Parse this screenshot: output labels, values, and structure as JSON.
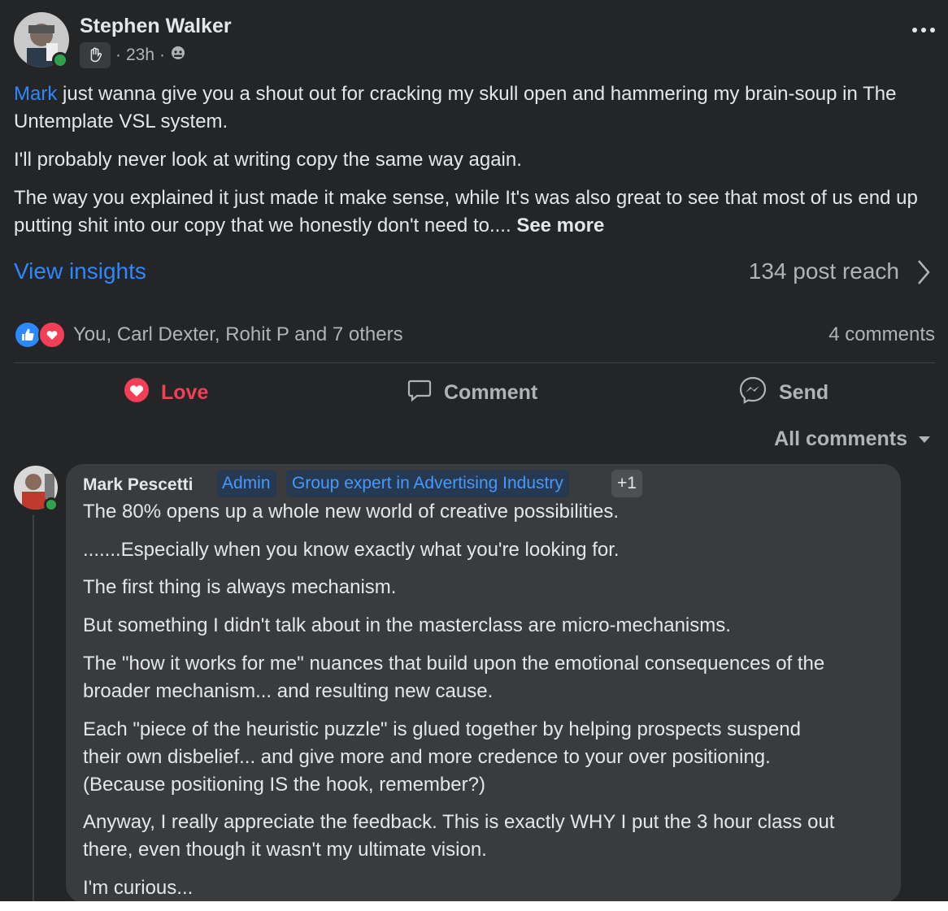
{
  "post": {
    "author": "Stephen Walker",
    "badge_icon": "waving-hand-icon",
    "time": "23h",
    "privacy_icon": "group-privacy-icon",
    "body": {
      "mention": "Mark",
      "p1_rest": " just wanna give you a shout out for cracking my skull open and hammering my brain-soup in The Untemplate VSL system.",
      "p2": "I'll probably never look at writing copy the same way again.",
      "p3": "The way you explained it just made it make sense, while It's was also great to see that most of us end up putting shit into our copy that we honestly don't need to.... ",
      "see_more": "See more"
    },
    "view_insights": "View insights",
    "reach": "134 post reach",
    "reactions_text": "You, Carl Dexter, Rohit P and 7 others",
    "comments_count": "4 comments"
  },
  "actions": {
    "love": "Love",
    "comment": "Comment",
    "send": "Send"
  },
  "comments_filter": "All comments",
  "comment": {
    "author": "Mark Pescetti",
    "tags": [
      "Admin",
      "Group expert in Advertising Industry",
      "+1"
    ],
    "paragraphs": [
      "The 80% opens up a whole new world of creative possibilities.",
      ".......Especially when you know exactly what you're looking for.",
      "The first thing is always mechanism.",
      "But something I didn't talk about in the masterclass are micro-mechanisms.",
      "The \"how it works for me\" nuances that build upon the emotional consequences of the broader mechanism... and resulting new cause.",
      "Each \"piece of the heuristic puzzle\" is glued together by helping prospects suspend their own disbelief... and give more and more credence to your over positioning. (Because positioning IS the hook, remember?)",
      "Anyway, I really appreciate the feedback. This is exactly WHY I put the 3 hour class out there, even though it wasn't my ultimate vision.",
      "I'm curious..."
    ]
  },
  "colors": {
    "background": "#242526",
    "link": "#2d88ff",
    "love": "#f33e58",
    "online": "#31a24c",
    "bubble": "#3a3b3c"
  }
}
